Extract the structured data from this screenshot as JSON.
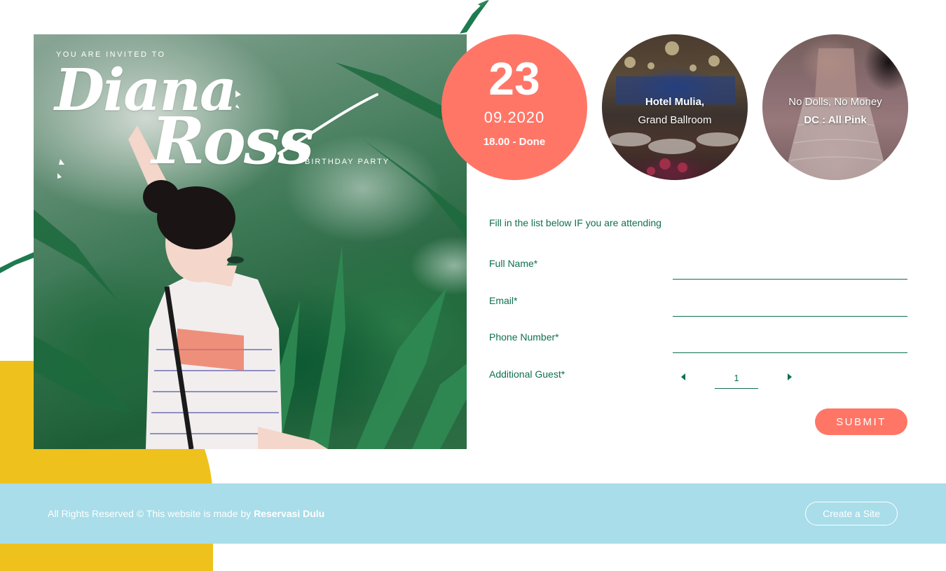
{
  "hero": {
    "invited_text": "YOU ARE INVITED TO",
    "name_line1": "Diana",
    "name_line2": "Ross",
    "event_text": "BIRTHDAY PARTY"
  },
  "date_circle": {
    "day": "23",
    "month_year": "09.2020",
    "time": "18.00 - Done"
  },
  "venue_circle": {
    "line1": "Hotel Mulia,",
    "line2": "Grand Ballroom"
  },
  "dress_circle": {
    "line1": "No Dolls, No Money",
    "line2": "DC : All Pink"
  },
  "form": {
    "intro": "Fill in the list below IF you are attending",
    "fields": [
      {
        "label": "Full Name*",
        "value": ""
      },
      {
        "label": "Email*",
        "value": ""
      },
      {
        "label": "Phone Number*",
        "value": ""
      }
    ],
    "guest_label": "Additional Guest*",
    "guest_value": "1",
    "submit_label": "SUBMIT"
  },
  "footer": {
    "text_prefix": "All Rights Reserved © This website is made by ",
    "brand": "Reservasi Dulu",
    "create_label": "Create a Site"
  },
  "colors": {
    "accent": "#ff7667",
    "form_text": "#0f6f53",
    "footer_bg": "#a8dde9",
    "yellow": "#efc11c"
  },
  "icons": {
    "stepper_decrease": "caret-left-icon",
    "stepper_increase": "caret-right-icon"
  }
}
